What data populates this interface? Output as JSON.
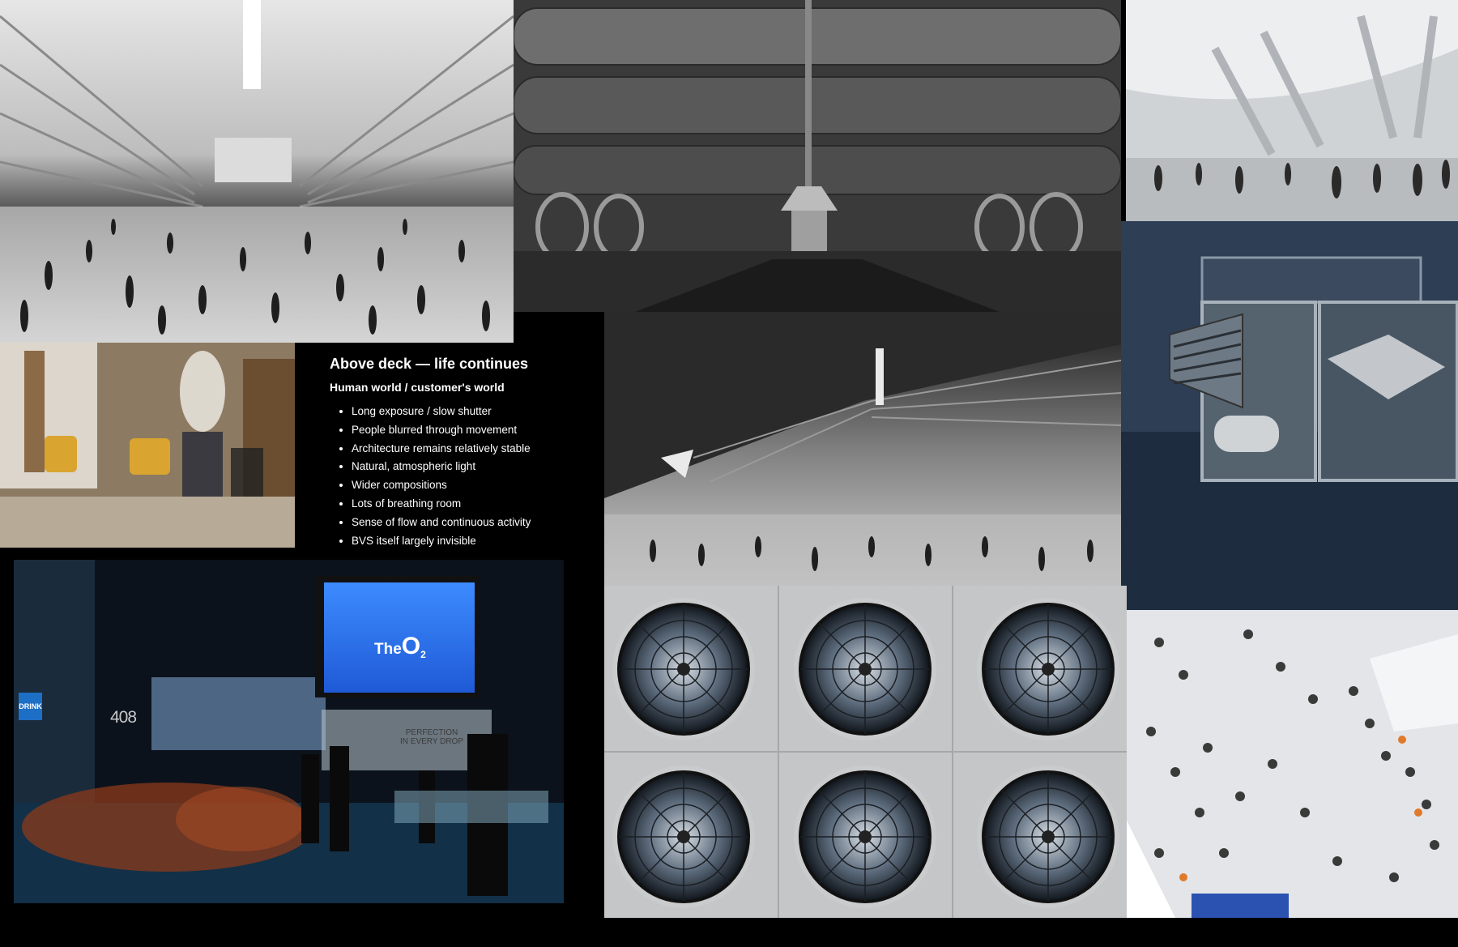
{
  "panel": {
    "title": "Above deck — life continues",
    "subtitle": "Human world / customer's world",
    "bullets": [
      "Long exposure / slow shutter",
      "People blurred through movement",
      "Architecture remains relatively stable",
      "Natural, atmospheric light",
      "Wider compositions",
      "Lots of breathing room",
      "Sense of flow and continuous activity",
      "BVS itself largely invisible"
    ]
  },
  "o2_photo": {
    "logo_word": "The",
    "logo_letter": "O",
    "logo_sub": "2",
    "drink_sign": "DRINK",
    "gate_number": "408",
    "banner_line_1": "PERFECTION",
    "banner_line_2": "IN EVERY DROP"
  },
  "colors": {
    "background": "#000000",
    "panel_text": "#ffffff",
    "o2_screen_blue": "#1f5ad6",
    "drink_sign_blue": "#1d6fc6"
  }
}
